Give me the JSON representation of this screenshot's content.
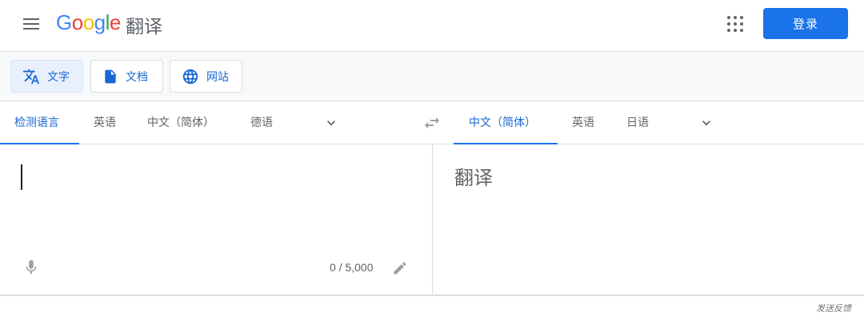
{
  "header": {
    "menu_icon": "hamburger-menu-icon",
    "logo_text": [
      "G",
      "o",
      "o",
      "g",
      "l",
      "e"
    ],
    "product_name": "翻译",
    "apps_icon": "apps-grid-icon",
    "login_label": "登录",
    "brand_color": "#1a73e8"
  },
  "modes": [
    {
      "label": "文字",
      "icon": "translate-icon",
      "active": true
    },
    {
      "label": "文档",
      "icon": "document-icon",
      "active": false
    },
    {
      "label": "网站",
      "icon": "globe-icon",
      "active": false
    }
  ],
  "source_languages": [
    {
      "label": "检测语言",
      "active": true
    },
    {
      "label": "英语",
      "active": false
    },
    {
      "label": "中文（简体）",
      "active": false
    },
    {
      "label": "德语",
      "active": false
    }
  ],
  "target_languages": [
    {
      "label": "中文（简体）",
      "active": true
    },
    {
      "label": "英语",
      "active": false
    },
    {
      "label": "日语",
      "active": false
    }
  ],
  "source": {
    "value": "",
    "char_count": "0 / 5,000",
    "mic_icon": "microphone-icon",
    "pencil_icon": "pencil-icon"
  },
  "target": {
    "placeholder": "翻译"
  },
  "footer": {
    "feedback_label": "发送反馈"
  }
}
